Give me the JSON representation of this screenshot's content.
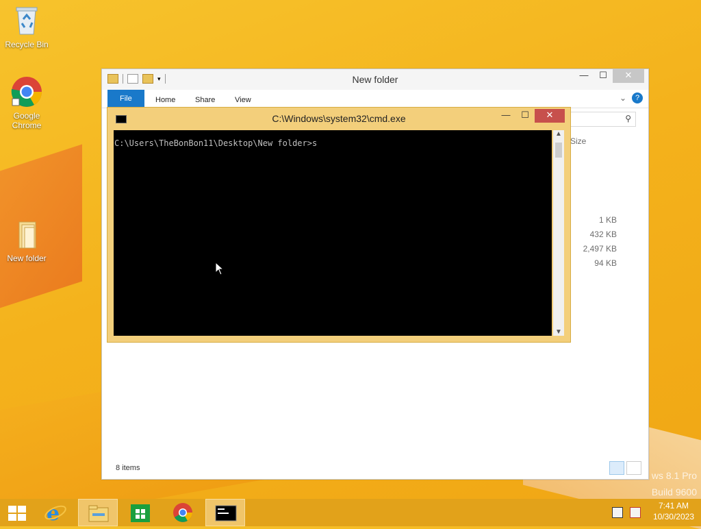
{
  "desktop": {
    "icons": [
      {
        "label": "Recycle Bin"
      },
      {
        "label": "Google Chrome"
      },
      {
        "label": "New folder"
      }
    ],
    "watermark_line1": "ws 8.1 Pro",
    "watermark_line2": "Build 9600"
  },
  "explorer": {
    "title": "New folder",
    "ribbon_tabs": [
      "File",
      "Home",
      "Share",
      "View"
    ],
    "column_size": "Size",
    "sizes": [
      "1 KB",
      "432 KB",
      "2,497 KB",
      "94 KB"
    ],
    "status": "8 items"
  },
  "cmd": {
    "title": "C:\\Windows\\system32\\cmd.exe",
    "line": "C:\\Users\\TheBonBon11\\Desktop\\New folder>s"
  },
  "taskbar": {
    "time": "7:41 AM",
    "date": "10/30/2023"
  },
  "colors": {
    "desktop": "#f4b21c",
    "ribbon_file": "#1979ca",
    "cmd_frame": "#f3cf7b",
    "cmd_close": "#c7504c"
  }
}
